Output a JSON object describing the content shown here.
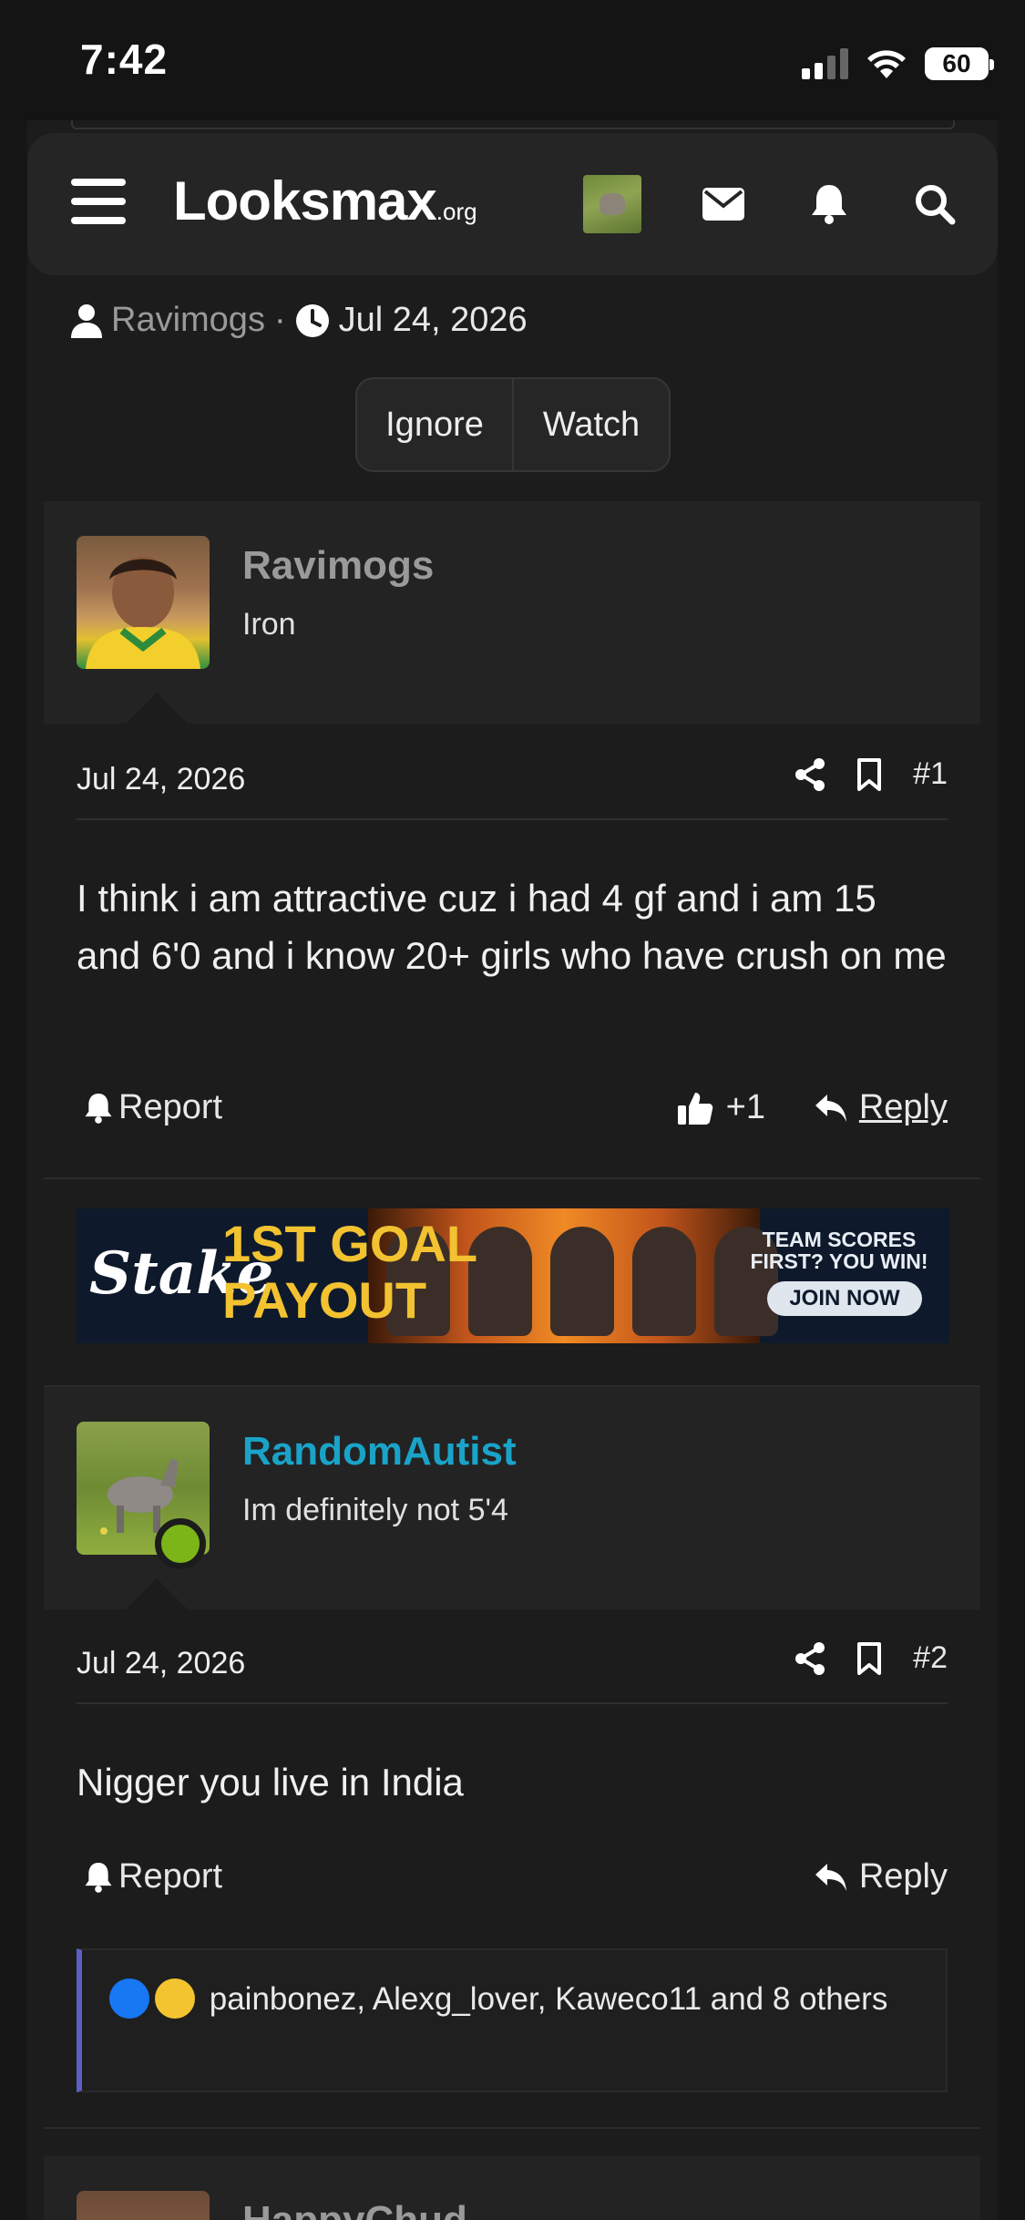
{
  "status_bar": {
    "time": "7:42",
    "battery": "60"
  },
  "nav": {
    "logo_main": "Looksmax",
    "logo_suffix": ".org"
  },
  "thread": {
    "author": "Ravimogs",
    "date": "Jul 24, 2026",
    "ignore_label": "Ignore",
    "watch_label": "Watch"
  },
  "posts": [
    {
      "username": "Ravimogs",
      "user_title": "Iron",
      "date": "Jul 24, 2026",
      "number": "#1",
      "body": "I think i am attractive cuz i had 4 gf and i am 15 and 6'0 and i know 20+ girls who have crush on me",
      "report_label": "Report",
      "reaction_count": "+1",
      "reply_label": "Reply",
      "username_color": "#9a9a9a"
    },
    {
      "username": "RandomAutist",
      "user_title": "Im definitely not 5'4",
      "date": "Jul 24, 2026",
      "number": "#2",
      "body": "Nigger you live in India",
      "report_label": "Report",
      "reply_label": "Reply",
      "reactions_summary": "painbonez, Alexg_lover, Kaweco11 and 8 others",
      "username_color": "#1aa3c8"
    },
    {
      "username": "HappyChud"
    }
  ],
  "ad": {
    "brand": "Stake",
    "headline_line1": "1ST GOAL",
    "headline_line2": "PAYOUT",
    "tagline": "TEAM SCORES FIRST? YOU WIN!",
    "cta": "JOIN NOW"
  }
}
